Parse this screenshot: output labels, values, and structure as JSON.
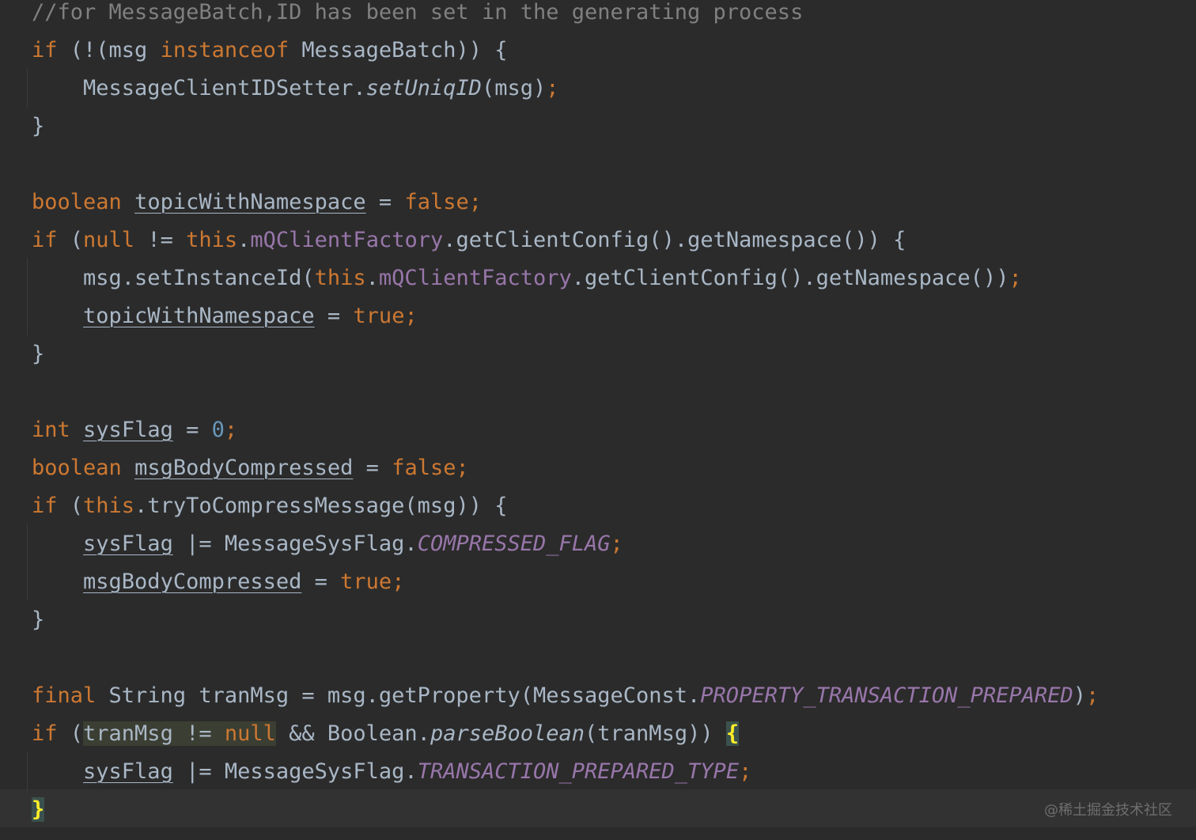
{
  "editor": {
    "watermark": "@稀土掘金技术社区",
    "lines": [
      [
        {
          "c": "cm",
          "t": "//for MessageBatch,ID has been set in the generating process"
        }
      ],
      [
        {
          "c": "kw",
          "t": "if"
        },
        {
          "c": "t",
          "t": " (!(msg "
        },
        {
          "c": "kw",
          "t": "instanceof"
        },
        {
          "c": "t",
          "t": " MessageBatch)) {"
        }
      ],
      [
        {
          "c": "t",
          "t": "    MessageClientIDSetter."
        },
        {
          "c": "ital",
          "t": "setUniqID"
        },
        {
          "c": "t",
          "t": "(msg)"
        },
        {
          "c": "semi",
          "t": ";"
        }
      ],
      [
        {
          "c": "t",
          "t": "}"
        }
      ],
      [],
      [
        {
          "c": "kw",
          "t": "boolean"
        },
        {
          "c": "t",
          "t": " "
        },
        {
          "c": "var",
          "t": "topicWithNamespace"
        },
        {
          "c": "t",
          "t": " = "
        },
        {
          "c": "kw",
          "t": "false"
        },
        {
          "c": "semi",
          "t": ";"
        }
      ],
      [
        {
          "c": "kw",
          "t": "if"
        },
        {
          "c": "t",
          "t": " ("
        },
        {
          "c": "kw",
          "t": "null"
        },
        {
          "c": "t",
          "t": " != "
        },
        {
          "c": "kw",
          "t": "this"
        },
        {
          "c": "t",
          "t": "."
        },
        {
          "c": "fld",
          "t": "mQClientFactory"
        },
        {
          "c": "t",
          "t": ".getClientConfig().getNamespace()) {"
        }
      ],
      [
        {
          "c": "t",
          "t": "    msg.setInstanceId("
        },
        {
          "c": "kw",
          "t": "this"
        },
        {
          "c": "t",
          "t": "."
        },
        {
          "c": "fld",
          "t": "mQClientFactory"
        },
        {
          "c": "t",
          "t": ".getClientConfig().getNamespace())"
        },
        {
          "c": "semi",
          "t": ";"
        }
      ],
      [
        {
          "c": "t",
          "t": "    "
        },
        {
          "c": "var",
          "t": "topicWithNamespace"
        },
        {
          "c": "t",
          "t": " = "
        },
        {
          "c": "kw",
          "t": "true"
        },
        {
          "c": "semi",
          "t": ";"
        }
      ],
      [
        {
          "c": "t",
          "t": "}"
        }
      ],
      [],
      [
        {
          "c": "kw",
          "t": "int"
        },
        {
          "c": "t",
          "t": " "
        },
        {
          "c": "var",
          "t": "sysFlag"
        },
        {
          "c": "t",
          "t": " = "
        },
        {
          "c": "num",
          "t": "0"
        },
        {
          "c": "semi",
          "t": ";"
        }
      ],
      [
        {
          "c": "kw",
          "t": "boolean"
        },
        {
          "c": "t",
          "t": " "
        },
        {
          "c": "var",
          "t": "msgBodyCompressed"
        },
        {
          "c": "t",
          "t": " = "
        },
        {
          "c": "kw",
          "t": "false"
        },
        {
          "c": "semi",
          "t": ";"
        }
      ],
      [
        {
          "c": "kw",
          "t": "if"
        },
        {
          "c": "t",
          "t": " ("
        },
        {
          "c": "kw",
          "t": "this"
        },
        {
          "c": "t",
          "t": ".tryToCompressMessage(msg)) {"
        }
      ],
      [
        {
          "c": "t",
          "t": "    "
        },
        {
          "c": "var",
          "t": "sysFlag"
        },
        {
          "c": "t",
          "t": " |= MessageSysFlag."
        },
        {
          "c": "sfld",
          "t": "COMPRESSED_FLAG"
        },
        {
          "c": "semi",
          "t": ";"
        }
      ],
      [
        {
          "c": "t",
          "t": "    "
        },
        {
          "c": "var",
          "t": "msgBodyCompressed"
        },
        {
          "c": "t",
          "t": " = "
        },
        {
          "c": "kw",
          "t": "true"
        },
        {
          "c": "semi",
          "t": ";"
        }
      ],
      [
        {
          "c": "t",
          "t": "}"
        }
      ],
      [],
      [
        {
          "c": "kw",
          "t": "final"
        },
        {
          "c": "t",
          "t": " String tranMsg = msg.getProperty(MessageConst."
        },
        {
          "c": "sfld",
          "t": "PROPERTY_TRANSACTION_PREPARED"
        },
        {
          "c": "t",
          "t": ")"
        },
        {
          "c": "semi",
          "t": ";"
        }
      ],
      [
        {
          "c": "kw",
          "t": "if"
        },
        {
          "c": "t",
          "t": " ("
        },
        {
          "c": "hl-range",
          "t": "tranMsg != "
        },
        {
          "c": "kw hl-range",
          "t": "null"
        },
        {
          "c": "t",
          "t": " && Boolean."
        },
        {
          "c": "ital",
          "t": "parseBoolean"
        },
        {
          "c": "t",
          "t": "(tranMsg)) "
        },
        {
          "c": "brace-match",
          "t": "{"
        }
      ],
      [
        {
          "c": "t",
          "t": "    "
        },
        {
          "c": "var",
          "t": "sysFlag"
        },
        {
          "c": "t",
          "t": " |= MessageSysFlag."
        },
        {
          "c": "sfld",
          "t": "TRANSACTION_PREPARED_TYPE"
        },
        {
          "c": "semi",
          "t": ";"
        }
      ],
      [
        {
          "c": "brace-match",
          "t": "}"
        }
      ]
    ]
  }
}
